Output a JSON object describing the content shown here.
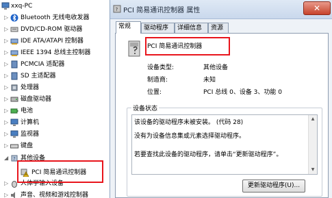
{
  "tree": {
    "root_label": "xxq-PC",
    "items": [
      {
        "label": "Bluetooth 无线电收发器",
        "icon": "bluetooth-icon"
      },
      {
        "label": "DVD/CD-ROM 驱动器",
        "icon": "optical-drive-icon"
      },
      {
        "label": "IDE ATA/ATAPI 控制器",
        "icon": "ide-controller-icon"
      },
      {
        "label": "IEEE 1394 总线主控制器",
        "icon": "ieee1394-icon"
      },
      {
        "label": "PCMCIA 适配器",
        "icon": "pcmcia-icon"
      },
      {
        "label": "SD 主适配器",
        "icon": "sd-adapter-icon"
      },
      {
        "label": "处理器",
        "icon": "processor-icon"
      },
      {
        "label": "磁盘驱动器",
        "icon": "disk-drive-icon"
      },
      {
        "label": "电池",
        "icon": "battery-icon"
      },
      {
        "label": "计算机",
        "icon": "computer-icon"
      },
      {
        "label": "监视器",
        "icon": "monitor-icon"
      },
      {
        "label": "键盘",
        "icon": "keyboard-icon"
      },
      {
        "label": "其他设备",
        "icon": "other-devices-icon"
      }
    ],
    "sub_item": {
      "label": "PCI 简易通讯控制器",
      "icon": "warning-device-icon"
    },
    "after_items": [
      {
        "label": "人体学输入设备",
        "icon": "hid-icon"
      },
      {
        "label": "声音、视频和游戏控制器",
        "icon": "sound-icon"
      }
    ]
  },
  "dialog": {
    "title": "PCI 简易通讯控制器 属性",
    "close_label": "✕",
    "tabs": [
      "常规",
      "驱动程序",
      "详细信息",
      "资源"
    ],
    "device_name": "PCI 简易通讯控制器",
    "props": [
      {
        "label": "设备类型:",
        "value": "其他设备"
      },
      {
        "label": "制造商:",
        "value": "未知"
      },
      {
        "label": "位置:",
        "value": "PCI 总线 0、设备 3、功能 0"
      }
    ],
    "status_title": "设备状态",
    "status_lines": [
      "该设备的驱动程序未被安装。 (代码 28)",
      "没有为设备信息集或元素选择驱动程序。",
      "若要查找此设备的驱动程序，请单击“更新驱动程序”。"
    ],
    "update_button": "更新驱动程序(U)..."
  }
}
